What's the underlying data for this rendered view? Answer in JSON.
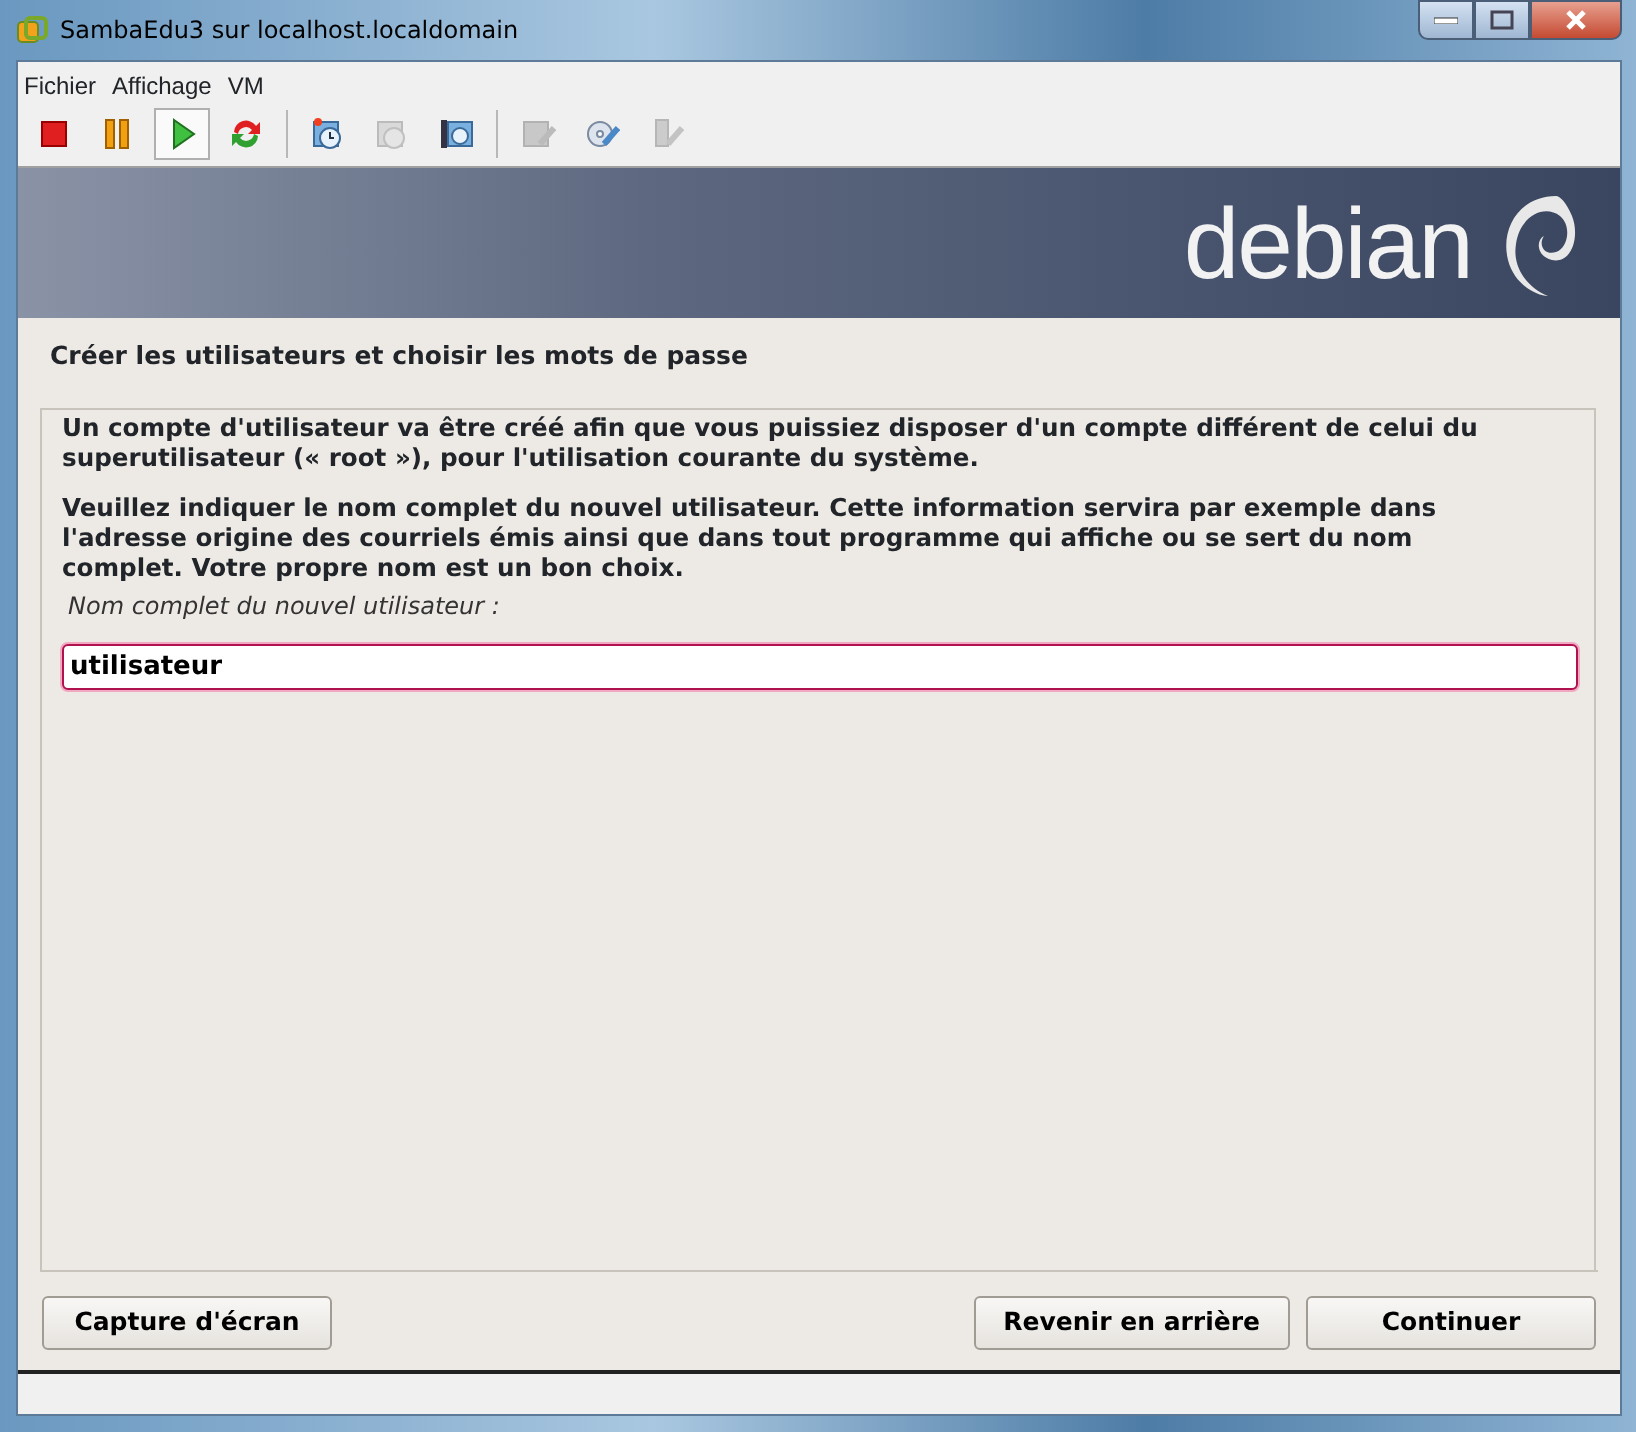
{
  "window": {
    "title": "SambaEdu3 sur localhost.localdomain"
  },
  "menu": [
    "Fichier",
    "Affichage",
    "VM"
  ],
  "toolbar": [
    {
      "kind": "stop",
      "selected": false,
      "disabled": false
    },
    {
      "kind": "pause",
      "selected": false,
      "disabled": false
    },
    {
      "kind": "play",
      "selected": true,
      "disabled": false
    },
    {
      "kind": "reset",
      "selected": false,
      "disabled": false
    },
    {
      "kind": "separator"
    },
    {
      "kind": "snapshot",
      "selected": false,
      "disabled": false
    },
    {
      "kind": "revert",
      "selected": false,
      "disabled": true
    },
    {
      "kind": "manage",
      "selected": false,
      "disabled": false
    },
    {
      "kind": "separator"
    },
    {
      "kind": "floppy",
      "selected": false,
      "disabled": true
    },
    {
      "kind": "cd",
      "selected": false,
      "disabled": false
    },
    {
      "kind": "usb",
      "selected": false,
      "disabled": true
    }
  ],
  "banner": {
    "logo": "debian"
  },
  "installer": {
    "heading": "Créer les utilisateurs et choisir les mots de passe",
    "paragraphs": [
      "Un compte d'utilisateur va être créé afin que vous puissiez disposer d'un compte différent de celui du superutilisateur (« root »), pour l'utilisation courante du système.",
      "Veuillez indiquer le nom complet du nouvel utilisateur. Cette information servira par exemple dans l'adresse origine des courriels émis ainsi que dans tout programme qui affiche ou se sert du nom complet. Votre propre nom est un bon choix."
    ],
    "field_label": "Nom complet du nouvel utilisateur :",
    "field_value": "utilisateur",
    "buttons": [
      {
        "label": "Capture d'écran",
        "kind": "left"
      },
      {
        "label": "Revenir en arrière",
        "kind": "right"
      },
      {
        "label": "Continuer",
        "kind": "right"
      }
    ]
  }
}
